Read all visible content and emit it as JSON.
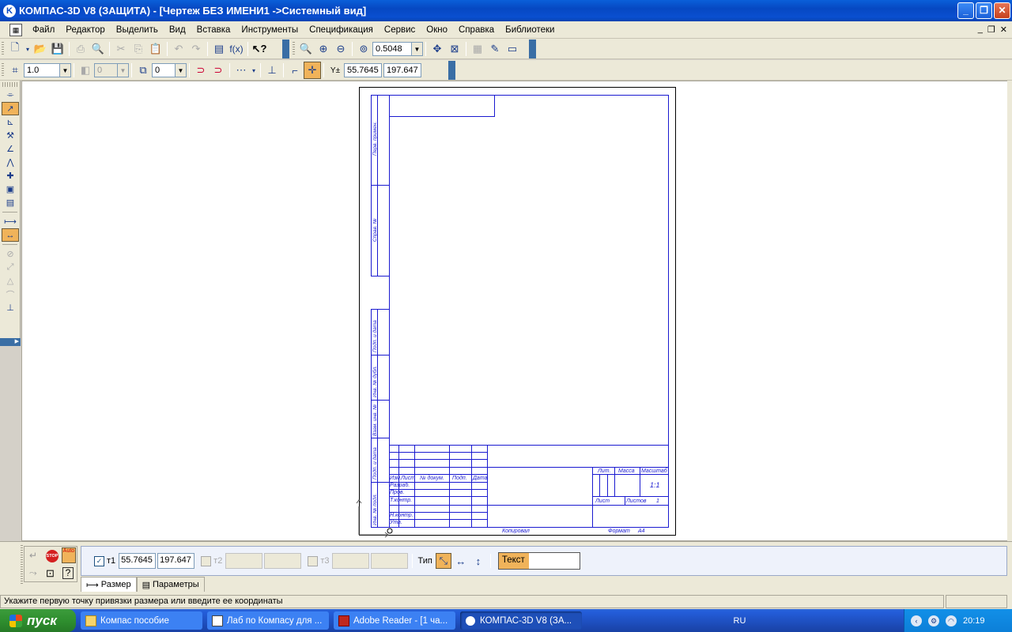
{
  "window": {
    "title": "КОМПАС-3D V8 (ЗАЩИТА) - [Чертеж БЕЗ ИМЕНИ1 ->Системный вид]"
  },
  "menu": {
    "items": [
      "Файл",
      "Редактор",
      "Выделить",
      "Вид",
      "Вставка",
      "Инструменты",
      "Спецификация",
      "Сервис",
      "Окно",
      "Справка",
      "Библиотеки"
    ]
  },
  "toolbar": {
    "zoom_value": "0.5048",
    "step_value": "1.0",
    "angle_value": "0",
    "layer_value": "0",
    "coord_x": "55.7645",
    "coord_y": "197.647"
  },
  "drawing": {
    "side_labels": [
      "Перв. примен.",
      "Справ. №",
      "Подп. и дата",
      "Инв. № дубл.",
      "Взам. инв. №",
      "Подп. и дата",
      "Инв. № подл."
    ],
    "tb_cols": [
      "Изм.",
      "Лист",
      "№ докум.",
      "Подп.",
      "Дата"
    ],
    "tb_rows": [
      "Разраб.",
      "Пров.",
      "Т.контр.",
      "Н.контр.",
      "Утв."
    ],
    "lit": "Лит.",
    "mass": "Масса",
    "scale": "Масштаб",
    "scale_value": "1:1",
    "sheet": "Лист",
    "sheets": "Листов",
    "sheets_value": "1",
    "copied": "Копировал",
    "format": "Формат",
    "format_value": "A4"
  },
  "property_panel": {
    "t1_label": "т1",
    "t1_x": "55.7645",
    "t1_y": "197.647",
    "t2_label": "т2",
    "t3_label": "т3",
    "type_label": "Тип",
    "text_label": "Текст",
    "text_value": "",
    "tabs": [
      "Размер",
      "Параметры"
    ]
  },
  "status": {
    "message": "Укажите первую точку привязки размера или введите ее координаты"
  },
  "taskbar": {
    "start": "пуск",
    "items": [
      "Компас пособие",
      "Лаб по Компасу для ...",
      "Adobe Reader - [1 ча...",
      "КОМПАС-3D V8 (ЗА..."
    ],
    "lang": "RU",
    "clock": "20:19"
  }
}
